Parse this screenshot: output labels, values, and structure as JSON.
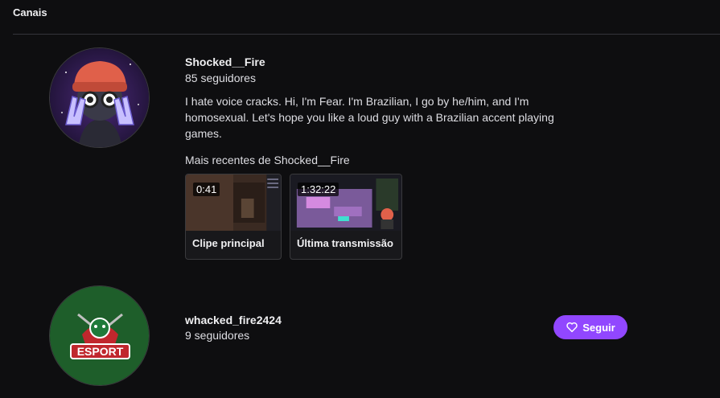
{
  "section": {
    "title": "Canais"
  },
  "channels": [
    {
      "name": "Shocked__Fire",
      "followers": "85 seguidores",
      "bio": "I hate voice cracks. Hi, I'm Fear. I'm Brazilian, I go by he/him, and I'm homosexual. Let's hope you like a loud guy with a Brazilian accent playing games.",
      "recent_title": "Mais recentes de Shocked__Fire",
      "recent": [
        {
          "duration": "0:41",
          "label": "Clipe principal"
        },
        {
          "duration": "1:32:22",
          "label": "Última transmissão"
        }
      ]
    },
    {
      "name": "whacked_fire2424",
      "followers": "9 seguidores",
      "follow_label": "Seguir",
      "avatar_logo_text": "ESPORT"
    }
  ],
  "colors": {
    "background": "#0e0e10",
    "accent": "#9147ff"
  }
}
